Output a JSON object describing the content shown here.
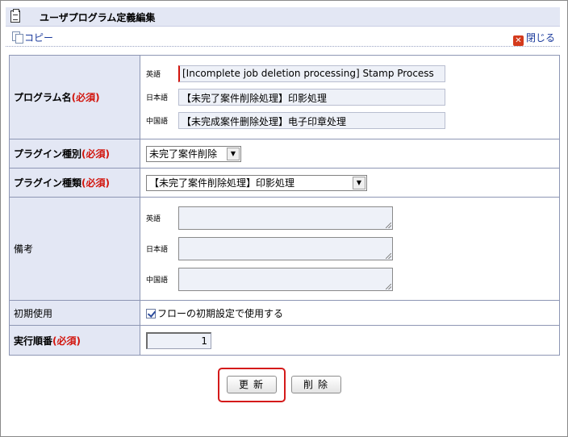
{
  "title": "ユーザプログラム定義編集",
  "toolbar": {
    "copy": "コピー",
    "close": "閉じる"
  },
  "program_name": {
    "label": "プログラム名",
    "required": "(必須)",
    "langs": [
      {
        "lang": "英語",
        "value": "[Incomplete job deletion processing] Stamp Process"
      },
      {
        "lang": "日本語",
        "value": "【未完了案件削除処理】印影処理"
      },
      {
        "lang": "中国語",
        "value": "【未完成案件删除处理】电子印章处理"
      }
    ]
  },
  "plugin_category": {
    "label": "プラグイン種別",
    "required": "(必須)",
    "selected": "未完了案件削除"
  },
  "plugin_type": {
    "label": "プラグイン種類",
    "required": "(必須)",
    "selected": "【未完了案件削除処理】印影処理"
  },
  "notes": {
    "label": "備考",
    "langs": [
      "英語",
      "日本語",
      "中国語"
    ]
  },
  "initial_use": {
    "label": "初期使用",
    "checkbox_label": "フローの初期設定で使用する",
    "checked": true
  },
  "execution_order": {
    "label": "実行順番",
    "required": "(必須)",
    "value": "1"
  },
  "buttons": {
    "update": "更新",
    "delete": "削除"
  },
  "colors": {
    "required": "#d2140c",
    "header_bg": "#e3e7f4",
    "highlight": "#d41a1a"
  },
  "icons": [
    "clipboard-icon",
    "copy-icon",
    "close-icon",
    "checkbox-checked-icon",
    "dropdown-arrow-icon"
  ]
}
